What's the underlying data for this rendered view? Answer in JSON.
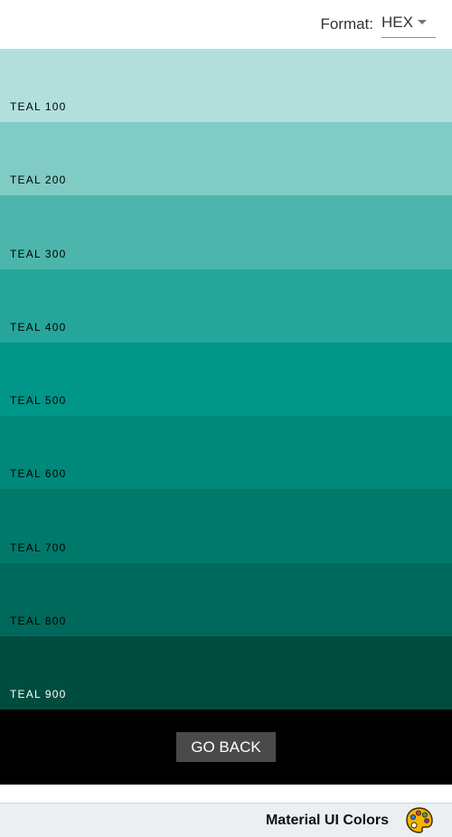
{
  "header": {
    "format_label": "Format:",
    "format_value": "HEX",
    "format_arrow_icon": "arrow-drop-down-icon"
  },
  "swatches": [
    {
      "label": "TEAL 100",
      "color": "#b2dfdb",
      "text_color": "#000000"
    },
    {
      "label": "TEAL 200",
      "color": "#80cbc4",
      "text_color": "#000000"
    },
    {
      "label": "TEAL 300",
      "color": "#4db6ac",
      "text_color": "#000000"
    },
    {
      "label": "TEAL 400",
      "color": "#26a69a",
      "text_color": "#000000"
    },
    {
      "label": "TEAL 500",
      "color": "#009688",
      "text_color": "#000000"
    },
    {
      "label": "TEAL 600",
      "color": "#00897b",
      "text_color": "#000000"
    },
    {
      "label": "TEAL 700",
      "color": "#00796b",
      "text_color": "#000000"
    },
    {
      "label": "TEAL 800",
      "color": "#00695c",
      "text_color": "#000000"
    },
    {
      "label": "TEAL 900",
      "color": "#004d40",
      "text_color": "#ffffff"
    }
  ],
  "back_button": {
    "label": "GO BACK"
  },
  "footer": {
    "title": "Material UI Colors",
    "icon": "palette-icon"
  }
}
